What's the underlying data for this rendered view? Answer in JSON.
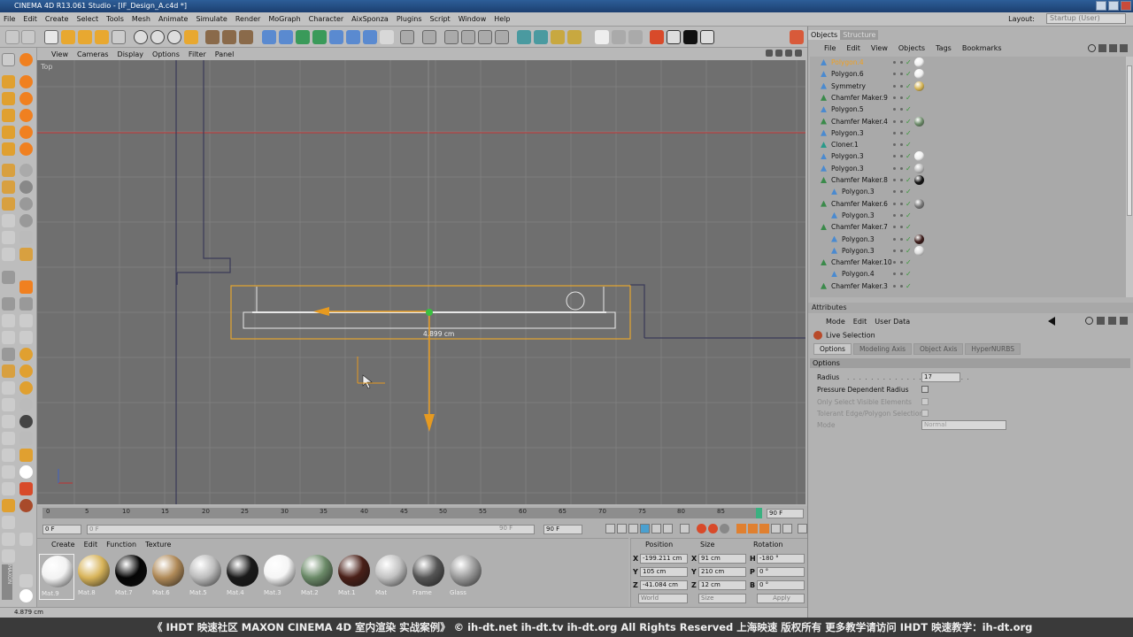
{
  "app": {
    "title": "CINEMA 4D R13.061 Studio - [IF_Design_A.c4d *]"
  },
  "menu": [
    "File",
    "Edit",
    "Create",
    "Select",
    "Tools",
    "Mesh",
    "Animate",
    "Simulate",
    "Render",
    "MoGraph",
    "Character",
    "AixSponza",
    "Plugins",
    "Script",
    "Window",
    "Help"
  ],
  "layout": {
    "label": "Layout:",
    "value": "Startup (User)"
  },
  "viewport": {
    "menu": [
      "View",
      "Cameras",
      "Display",
      "Options",
      "Filter",
      "Panel"
    ],
    "name": "Top",
    "measure": "4.899 cm"
  },
  "timeline": {
    "ticks": [
      "0",
      "5",
      "10",
      "15",
      "20",
      "25",
      "30",
      "35",
      "40",
      "45",
      "50",
      "55",
      "60",
      "65",
      "70",
      "75",
      "80",
      "85"
    ],
    "end_frame": "90 F",
    "start_field": "0 F",
    "current_field": "0 F",
    "end_field": "90 F",
    "max_field": "90 F"
  },
  "materials": {
    "menu": [
      "Create",
      "Edit",
      "Function",
      "Texture"
    ],
    "items": [
      {
        "name": "Mat.9",
        "color": "#f2f2f2"
      },
      {
        "name": "Mat.8",
        "color": "#d8b45a"
      },
      {
        "name": "Mat.7",
        "color": "#050505"
      },
      {
        "name": "Mat.6",
        "color": "#b08a58"
      },
      {
        "name": "Mat.5",
        "color": "#bdbdbd"
      },
      {
        "name": "Mat.4",
        "color": "#1a1a1a"
      },
      {
        "name": "Mat.3",
        "color": "#f5f5f5"
      },
      {
        "name": "Mat.2",
        "color": "#6b8a68"
      },
      {
        "name": "Mat.1",
        "color": "#4a2018"
      },
      {
        "name": "Mat",
        "color": "#c2c2c2"
      },
      {
        "name": "Frame",
        "color": "#555555"
      },
      {
        "name": "Glass",
        "color": "#9a9a9a"
      }
    ]
  },
  "coords": {
    "headers": [
      "Position",
      "Size",
      "Rotation"
    ],
    "rows": [
      {
        "axis": "X",
        "pos": "-199.211 cm",
        "size_axis": "X",
        "size": "91 cm",
        "rot_axis": "H",
        "rot": "-180 °"
      },
      {
        "axis": "Y",
        "pos": "105 cm",
        "size_axis": "Y",
        "size": "210 cm",
        "rot_axis": "P",
        "rot": "0 °"
      },
      {
        "axis": "Z",
        "pos": "-41.084 cm",
        "size_axis": "Z",
        "size": "12 cm",
        "rot_axis": "B",
        "rot": "0 °"
      }
    ],
    "mode": "World",
    "size_mode": "Size",
    "apply": "Apply"
  },
  "status": "4.879 cm",
  "objects": {
    "tabs": [
      "Objects",
      "Structure"
    ],
    "menu": [
      "File",
      "Edit",
      "View",
      "Objects",
      "Tags",
      "Bookmarks"
    ],
    "items": [
      {
        "name": "Polygon.4",
        "indent": 0,
        "type": "poly",
        "selected": true,
        "tag": "#f0f0f0"
      },
      {
        "name": "Polygon.6",
        "indent": 0,
        "type": "poly",
        "tag": "#f0f0f0"
      },
      {
        "name": "Symmetry",
        "indent": 0,
        "type": "sym",
        "tag": "#d6b452"
      },
      {
        "name": "Chamfer Maker.9",
        "indent": 0,
        "type": "chamfer",
        "tag": ""
      },
      {
        "name": "Polygon.5",
        "indent": 0,
        "type": "poly",
        "tag": ""
      },
      {
        "name": "Chamfer Maker.4",
        "indent": 0,
        "type": "chamfer",
        "tag": "#6b8a68"
      },
      {
        "name": "Polygon.3",
        "indent": 0,
        "type": "poly",
        "tag": ""
      },
      {
        "name": "Cloner.1",
        "indent": 0,
        "type": "cloner",
        "tag": ""
      },
      {
        "name": "Polygon.3",
        "indent": 0,
        "type": "poly",
        "tag": "#f0f0f0"
      },
      {
        "name": "Polygon.3",
        "indent": 0,
        "type": "poly",
        "tag": "#bbbbbb"
      },
      {
        "name": "Chamfer Maker.8",
        "indent": 0,
        "type": "chamfer",
        "tag": "#111111"
      },
      {
        "name": "Polygon.3",
        "indent": 1,
        "type": "poly",
        "tag": ""
      },
      {
        "name": "Chamfer Maker.6",
        "indent": 0,
        "type": "chamfer",
        "tag": "#777777"
      },
      {
        "name": "Polygon.3",
        "indent": 1,
        "type": "poly",
        "tag": ""
      },
      {
        "name": "Chamfer Maker.7",
        "indent": 0,
        "type": "chamfer",
        "tag": ""
      },
      {
        "name": "Polygon.3",
        "indent": 1,
        "type": "poly",
        "tag": "#3a1a18"
      },
      {
        "name": "Polygon.3",
        "indent": 1,
        "type": "poly",
        "tag": "#dddddd"
      },
      {
        "name": "Chamfer Maker.10",
        "indent": 0,
        "type": "chamfer",
        "tag": ""
      },
      {
        "name": "Polygon.4",
        "indent": 1,
        "type": "poly",
        "tag": ""
      },
      {
        "name": "Chamfer Maker.3",
        "indent": 0,
        "type": "chamfer",
        "tag": ""
      }
    ]
  },
  "attributes": {
    "header": "Attributes",
    "menu": [
      "Mode",
      "Edit",
      "User Data"
    ],
    "tool": "Live Selection",
    "tabs": [
      "Options",
      "Modeling Axis",
      "Object Axis",
      "HyperNURBS"
    ],
    "section": "Options",
    "radius_label": "Radius",
    "radius_value": "17",
    "pressure_label": "Pressure Dependent Radius",
    "visible_label": "Only Select Visible Elements",
    "tolerant_label": "Tolerant Edge/Polygon Selection",
    "mode_label": "Mode",
    "mode_value": "Normal"
  },
  "banner": "《 IHDT 映速社区 MAXON CINEMA 4D 室内渲染 实战案例》  © ih-dt.net ih-dt.tv  ih-dt.org  All Rights Reserved 上海映速 版权所有    更多教学请访问 IHDT 映速教学：ih-dt.org",
  "colors": {
    "accent": "#f0a020",
    "selection_outline": "#e6a630",
    "axis_red": "#c03030"
  }
}
